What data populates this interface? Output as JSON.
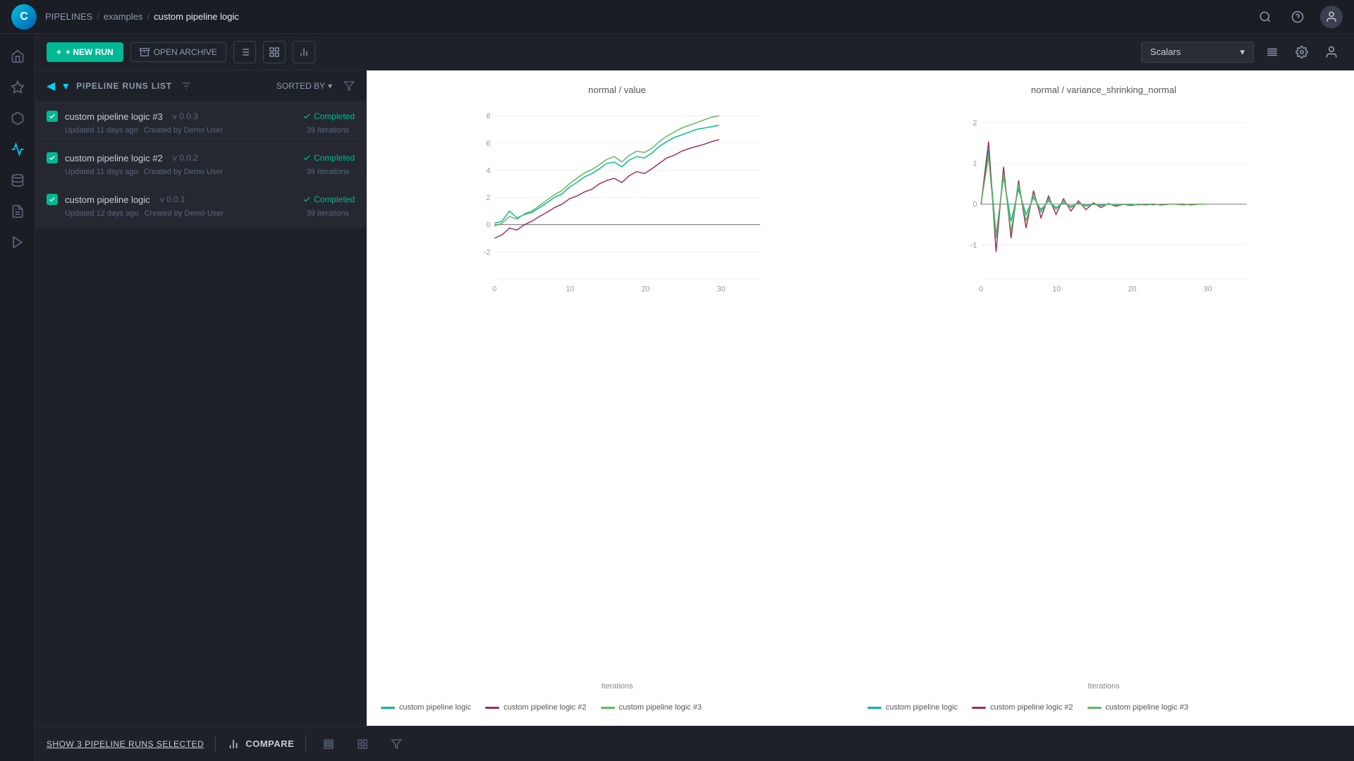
{
  "app": {
    "logo": "C",
    "breadcrumb": {
      "root": "PIPELINES",
      "sep1": "/",
      "parent": "examples",
      "sep2": "/",
      "current": "custom pipeline logic"
    }
  },
  "toolbar": {
    "new_run_label": "+ NEW RUN",
    "open_archive_label": "OPEN ARCHIVE",
    "scalars_label": "Scalars",
    "view_list_icon": "☰",
    "view_grid_icon": "⊞",
    "view_chart_icon": "⬡"
  },
  "runs_panel": {
    "title": "PIPELINE RUNS LIST",
    "sorted_by_label": "SORTED BY",
    "runs": [
      {
        "name": "custom pipeline logic #3",
        "version": "v 0.0.3",
        "status": "Completed",
        "updated": "Updated 11 days ago",
        "created_by": "Created by Demo User",
        "iterations": "39 Iterations",
        "checked": true
      },
      {
        "name": "custom pipeline logic #2",
        "version": "v 0.0.2",
        "status": "Completed",
        "updated": "Updated 11 days ago",
        "created_by": "Created by Demo User",
        "iterations": "39 Iterations",
        "checked": true
      },
      {
        "name": "custom pipeline logic",
        "version": "v 0.0.1",
        "status": "Completed",
        "updated": "Updated 12 days ago",
        "created_by": "Created by Demo User",
        "iterations": "39 Iterations",
        "checked": true
      }
    ]
  },
  "charts": {
    "chart1": {
      "title": "normal / value",
      "x_label": "Iterations",
      "legend": [
        {
          "label": "custom pipeline logic",
          "color": "#00b894"
        },
        {
          "label": "custom pipeline logic #2",
          "color": "#9b2c5e"
        },
        {
          "label": "custom pipeline logic #3",
          "color": "#5cb85c"
        }
      ]
    },
    "chart2": {
      "title": "normal / variance_shrinking_normal",
      "x_label": "Iterations",
      "legend": [
        {
          "label": "custom pipeline logic",
          "color": "#00b894"
        },
        {
          "label": "custom pipeline logic #2",
          "color": "#9b2c5e"
        },
        {
          "label": "custom pipeline logic #3",
          "color": "#5cb85c"
        }
      ]
    }
  },
  "bottom_bar": {
    "show_selected_label": "SHOW 3 PIPELINE RUNS SELECTED",
    "compare_label": "COMPARE"
  },
  "sidebar": {
    "icons": [
      {
        "name": "home",
        "symbol": "⌂"
      },
      {
        "name": "experiments",
        "symbol": "◈"
      },
      {
        "name": "models",
        "symbol": "⬡"
      },
      {
        "name": "pipeline",
        "symbol": "⛓"
      },
      {
        "name": "data",
        "symbol": "⬛"
      },
      {
        "name": "reports",
        "symbol": "≡"
      },
      {
        "name": "deploy",
        "symbol": "▷"
      }
    ]
  }
}
